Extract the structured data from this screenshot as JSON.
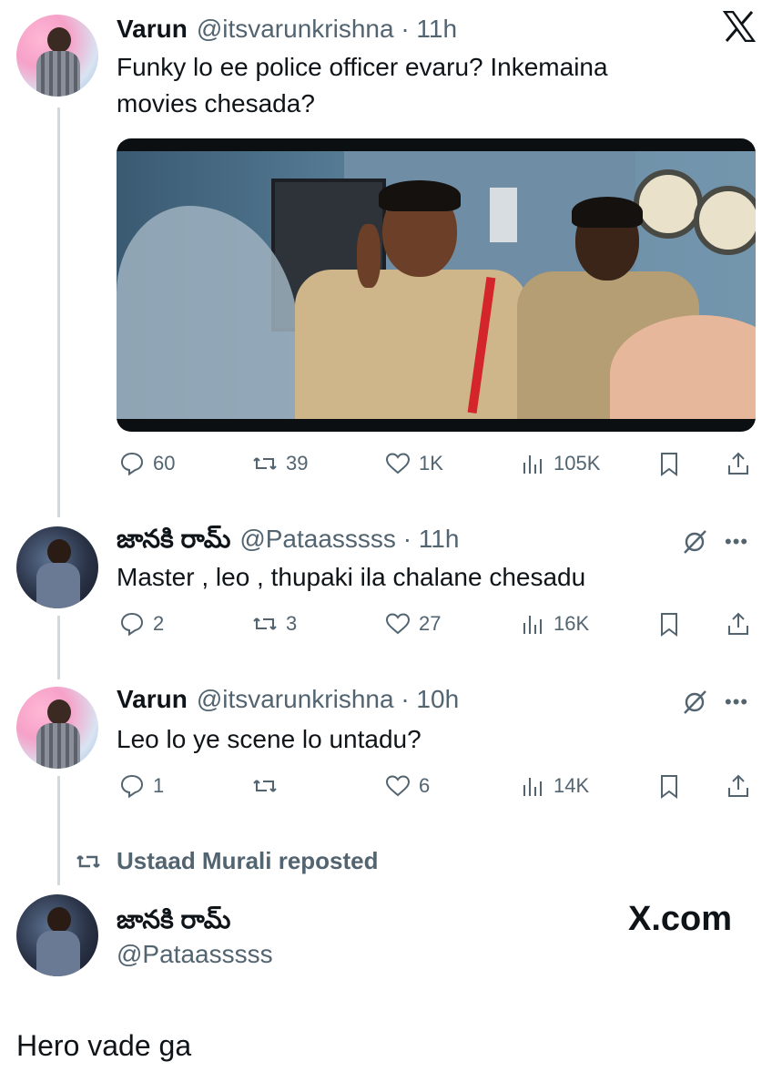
{
  "tweets": [
    {
      "name": "Varun",
      "handle": "@itsvarunkrishna · 11h",
      "text_line1": "Funky lo ee police officer evaru? Inkemaina",
      "text_line2": "movies chesada?",
      "stats": {
        "replies": "60",
        "reposts": "39",
        "likes": "1K",
        "views": "105K"
      }
    },
    {
      "name": "జానకి రామ్",
      "handle": "@Pataasssss · 11h",
      "text_line1": "Master , leo , thupaki ila chalane chesadu",
      "stats": {
        "replies": "2",
        "reposts": "3",
        "likes": "27",
        "views": "16K"
      }
    },
    {
      "name": "Varun",
      "handle": "@itsvarunkrishna · 10h",
      "text_line1": "Leo lo ye scene lo untadu?",
      "stats": {
        "replies": "1",
        "reposts": "",
        "likes": "6",
        "views": "14K"
      }
    }
  ],
  "repost_banner": "Ustaad Murali reposted",
  "final_tweet": {
    "name": "జానకి రామ్",
    "handle": "@Pataasssss",
    "text": "Hero vade ga"
  },
  "branding": {
    "xcom": "X.com"
  },
  "icons": {
    "reply": "reply-icon",
    "repost": "repost-icon",
    "like": "heart-icon",
    "views": "views-icon",
    "bookmark": "bookmark-icon",
    "share": "share-icon",
    "grok": "grok-icon",
    "more": "more-icon",
    "logo": "x-logo-icon"
  },
  "colors": {
    "text": "#0f1419",
    "secondary": "#536471",
    "thread_line": "#cfd9de"
  }
}
